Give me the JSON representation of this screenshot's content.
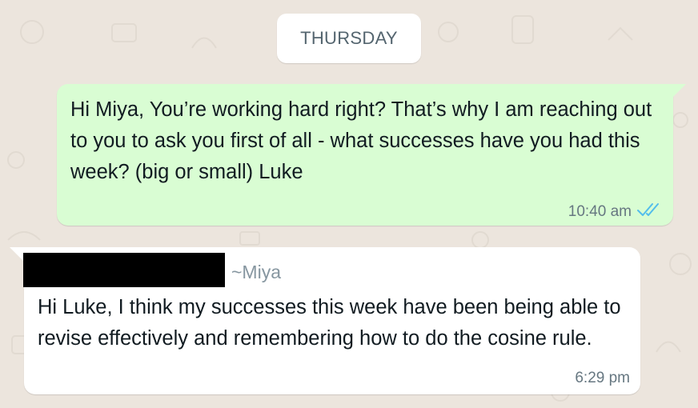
{
  "colors": {
    "chat_background": "#ece5dd",
    "outgoing_bubble": "#d9fdd3",
    "incoming_bubble": "#ffffff",
    "read_ticks": "#53bdeb"
  },
  "date_divider": {
    "label": "THURSDAY"
  },
  "messages": [
    {
      "direction": "outgoing",
      "text": "Hi Miya, You’re working hard right? That’s why I am reaching out to you to ask you first of all - what successes have you had this week? (big or small) Luke",
      "time": "10:40 am",
      "status_icon": "double-check-read-icon"
    },
    {
      "direction": "incoming",
      "sender": "~Miya",
      "sender_redacted": true,
      "text": "Hi Luke, I think my successes this week have been being able to revise effectively and remembering how to do the cosine rule.",
      "time": "6:29 pm"
    }
  ]
}
